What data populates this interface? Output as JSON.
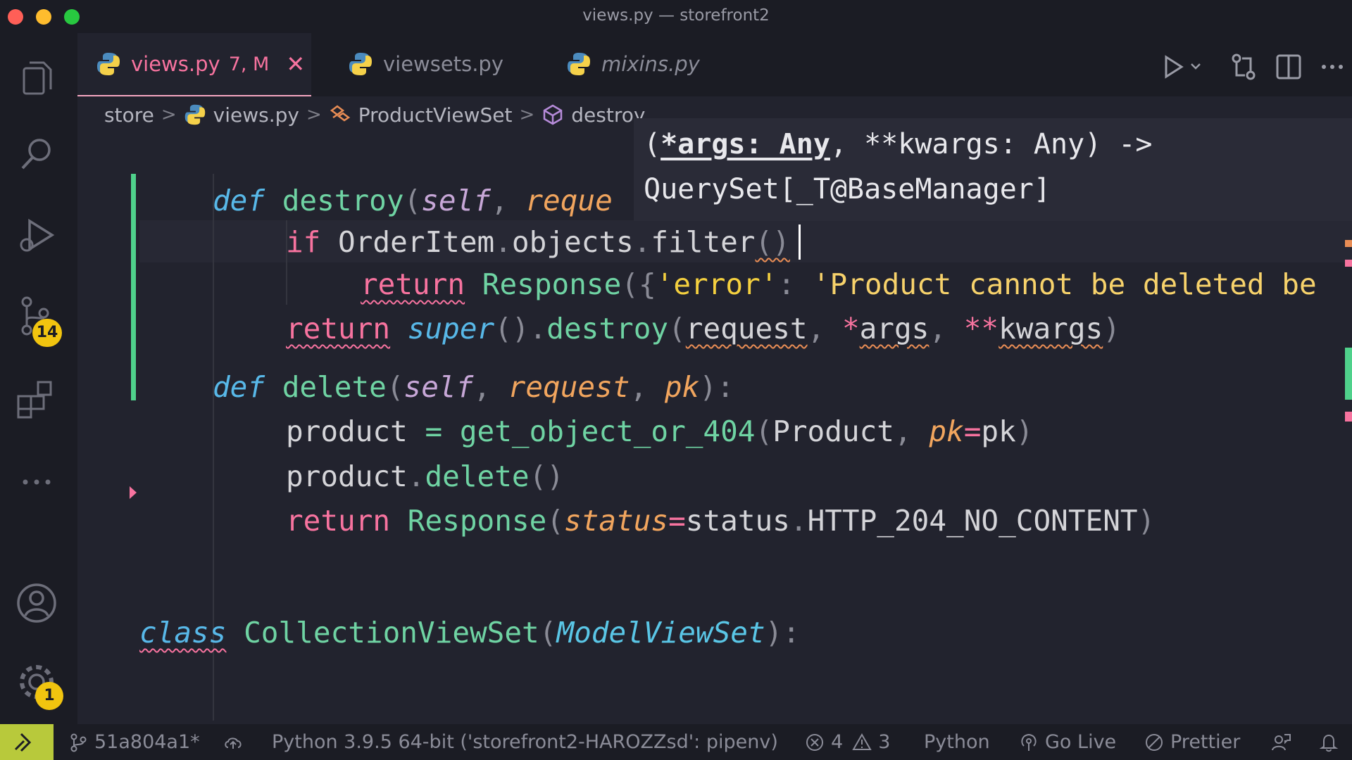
{
  "window": {
    "title": "views.py — storefront2"
  },
  "activity_bar": {
    "icons": [
      "explorer-icon",
      "search-icon",
      "run-debug-icon",
      "source-control-icon",
      "extensions-icon",
      "more-icon",
      "account-icon",
      "settings-gear-icon"
    ],
    "source_control_badge": "14",
    "settings_badge": "1"
  },
  "tabs": [
    {
      "label": "views.py",
      "status": "7, M",
      "active": true
    },
    {
      "label": "viewsets.py",
      "active": false
    },
    {
      "label": "mixins.py",
      "active": false,
      "preview": true
    }
  ],
  "breadcrumbs": [
    "store",
    "views.py",
    "ProductViewSet",
    "destroy"
  ],
  "editor": {
    "lines": {
      "l1_def": "def",
      "l1_name": "destroy",
      "l1_open": "(",
      "l1_self": "self",
      "l1_comma": ", ",
      "l1_param": "reque",
      "l2_if": "if",
      "l2_rest": " OrderItem",
      "l2_dot1": ".",
      "l2_objects": "objects",
      "l2_dot2": ".",
      "l2_filter": "filter",
      "l2_parens": "()",
      "l3_return": "return",
      "l3_resp": " Response",
      "l3_open": "({",
      "l3_key": "'error'",
      "l3_colon": ": ",
      "l3_val": "'Product cannot be deleted be",
      "l4_return": "return",
      "l4_super": " super",
      "l4_paren": "().",
      "l4_destroy": "destroy",
      "l4_open": "(",
      "l4_request": "request",
      "l4_comma1": ", ",
      "l4_star1": "*",
      "l4_args": "args",
      "l4_comma2": ", ",
      "l4_star2": "**",
      "l4_kwargs": "kwargs",
      "l4_close": ")",
      "l5_def": "def",
      "l5_name": " delete",
      "l5_open": "(",
      "l5_self": "self",
      "l5_c1": ", ",
      "l5_request": "request",
      "l5_c2": ", ",
      "l5_pk": "pk",
      "l5_close": "):",
      "l6_product": "product",
      "l6_eq": " = ",
      "l6_fn": "get_object_or_404",
      "l6_open": "(",
      "l6_arg": "Product",
      "l6_comma": ", ",
      "l6_kw": "pk",
      "l6_eq2": "=",
      "l6_val": "pk",
      "l6_close": ")",
      "l7_product": "product",
      "l7_dot": ".",
      "l7_fn": "delete",
      "l7_parens": "()",
      "l8_return": "return",
      "l8_resp": " Response",
      "l8_open": "(",
      "l8_kw": "status",
      "l8_eq": "=",
      "l8_val": "status",
      "l8_dot": ".",
      "l8_const": "HTTP_204_NO_CONTENT",
      "l8_close": ")",
      "l9_class": "class",
      "l9_name": " CollectionViewSet",
      "l9_open": "(",
      "l9_base": "ModelViewSet",
      "l9_close": "):"
    }
  },
  "hover": {
    "line1_open": "(",
    "line1_param1": "*args: Any",
    "line1_rest": ", **kwargs: Any) ->",
    "line2": "QuerySet[_T@BaseManager]"
  },
  "status_bar": {
    "branch": "51a804a1*",
    "interpreter": "Python 3.9.5 64-bit ('storefront2-HAROZZsd': pipenv)",
    "errors": "4",
    "warnings": "3",
    "language": "Python",
    "go_live": "Go Live",
    "prettier": "Prettier"
  },
  "colors": {
    "accent_pink": "#f7739f",
    "modified_green": "#4fd18b",
    "badge_yellow": "#f1c40f",
    "remote_lime": "#b8c93b"
  }
}
